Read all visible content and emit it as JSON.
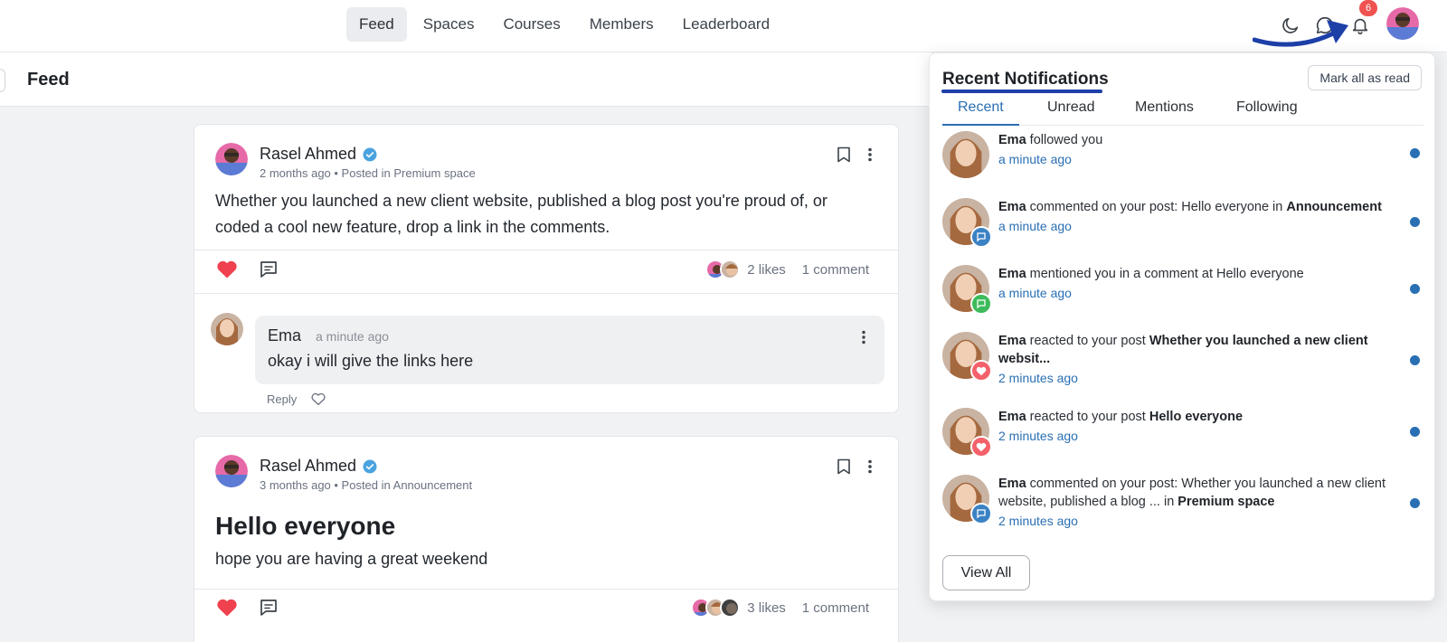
{
  "nav": {
    "items": [
      "Feed",
      "Spaces",
      "Courses",
      "Members",
      "Leaderboard"
    ],
    "active": "Feed",
    "notification_count": "6"
  },
  "subheader": {
    "title": "Feed"
  },
  "posts": [
    {
      "author": "Rasel Ahmed",
      "meta": "2 months ago • Posted in Premium space",
      "body_line1": "Whether you launched a new client website, published a blog post you're proud of, or",
      "body_line2": "coded a cool new feature, drop a link in the comments.",
      "likes": "2 likes",
      "comments": "1 comment",
      "comment": {
        "author": "Ema",
        "time": "a minute ago",
        "text": "okay i will give the links here",
        "reply_label": "Reply"
      }
    },
    {
      "author": "Rasel Ahmed",
      "meta": "3 months ago • Posted in Announcement",
      "title": "Hello everyone",
      "body": "hope you are having a great weekend",
      "likes": "3 likes",
      "comments": "1 comment"
    }
  ],
  "notifications": {
    "title": "Recent Notifications",
    "mark_all_read": "Mark all as read",
    "tabs": [
      "Recent",
      "Unread",
      "Mentions",
      "Following"
    ],
    "active_tab": "Recent",
    "items": [
      {
        "actor": "Ema",
        "text": " followed you",
        "target": "",
        "suffix": "",
        "space": "",
        "time": "a minute ago",
        "badge": ""
      },
      {
        "actor": "Ema",
        "text": " commented on your post: Hello everyone in ",
        "target": "",
        "suffix": "",
        "space": "Announcement",
        "time": "a minute ago",
        "badge": "comment"
      },
      {
        "actor": "Ema",
        "text": " mentioned you in a comment at Hello everyone",
        "target": "",
        "suffix": "",
        "space": "",
        "time": "a minute ago",
        "badge": "mention"
      },
      {
        "actor": "Ema",
        "text": " reacted to your post ",
        "target": "Whether you launched a new client websit...",
        "suffix": "",
        "space": "",
        "time": "2 minutes ago",
        "badge": "heart"
      },
      {
        "actor": "Ema",
        "text": " reacted to your post ",
        "target": "Hello everyone",
        "suffix": "",
        "space": "",
        "time": "2 minutes ago",
        "badge": "heart"
      },
      {
        "actor": "Ema",
        "text": " commented on your post: Whether you launched a new client website, published a blog ... in ",
        "target": "",
        "suffix": "",
        "space": "Premium space",
        "time": "2 minutes ago",
        "badge": "comment"
      }
    ],
    "view_all": "View All"
  },
  "colors": {
    "accent": "#2a6fb3",
    "heart": "#f0414f",
    "badge_comment": "#3b82c4",
    "badge_mention": "#3dbb5a",
    "badge_heart": "#f4616b",
    "annotation": "#1d3fa8"
  }
}
